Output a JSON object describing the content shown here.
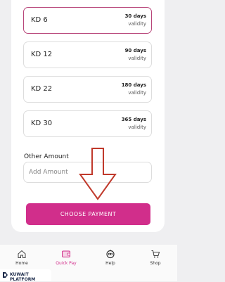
{
  "plans": [
    {
      "amount": "KD 6",
      "days": "30 days",
      "validity": "validity",
      "selected": true
    },
    {
      "amount": "KD 12",
      "days": "90 days",
      "validity": "validity",
      "selected": false
    },
    {
      "amount": "KD 22",
      "days": "180 days",
      "validity": "validity",
      "selected": false
    },
    {
      "amount": "KD 30",
      "days": "365 days",
      "validity": "validity",
      "selected": false
    }
  ],
  "other_amount": {
    "label": "Other Amount",
    "placeholder": "Add Amount",
    "value": ""
  },
  "choose_payment": "CHOOSE PAYMENT",
  "nav": [
    {
      "label": "Home",
      "icon": "home-icon",
      "active": false
    },
    {
      "label": "Quick Pay",
      "icon": "wallet-icon",
      "active": true
    },
    {
      "label": "Help",
      "icon": "robot-icon",
      "active": false
    },
    {
      "label": "Shop",
      "icon": "cart-icon",
      "active": false
    }
  ],
  "watermark": "KUWAIT PLATFORM",
  "colors": {
    "accent": "#d12e8b",
    "selected_border": "#b8467a",
    "arrow": "#c0392b"
  }
}
